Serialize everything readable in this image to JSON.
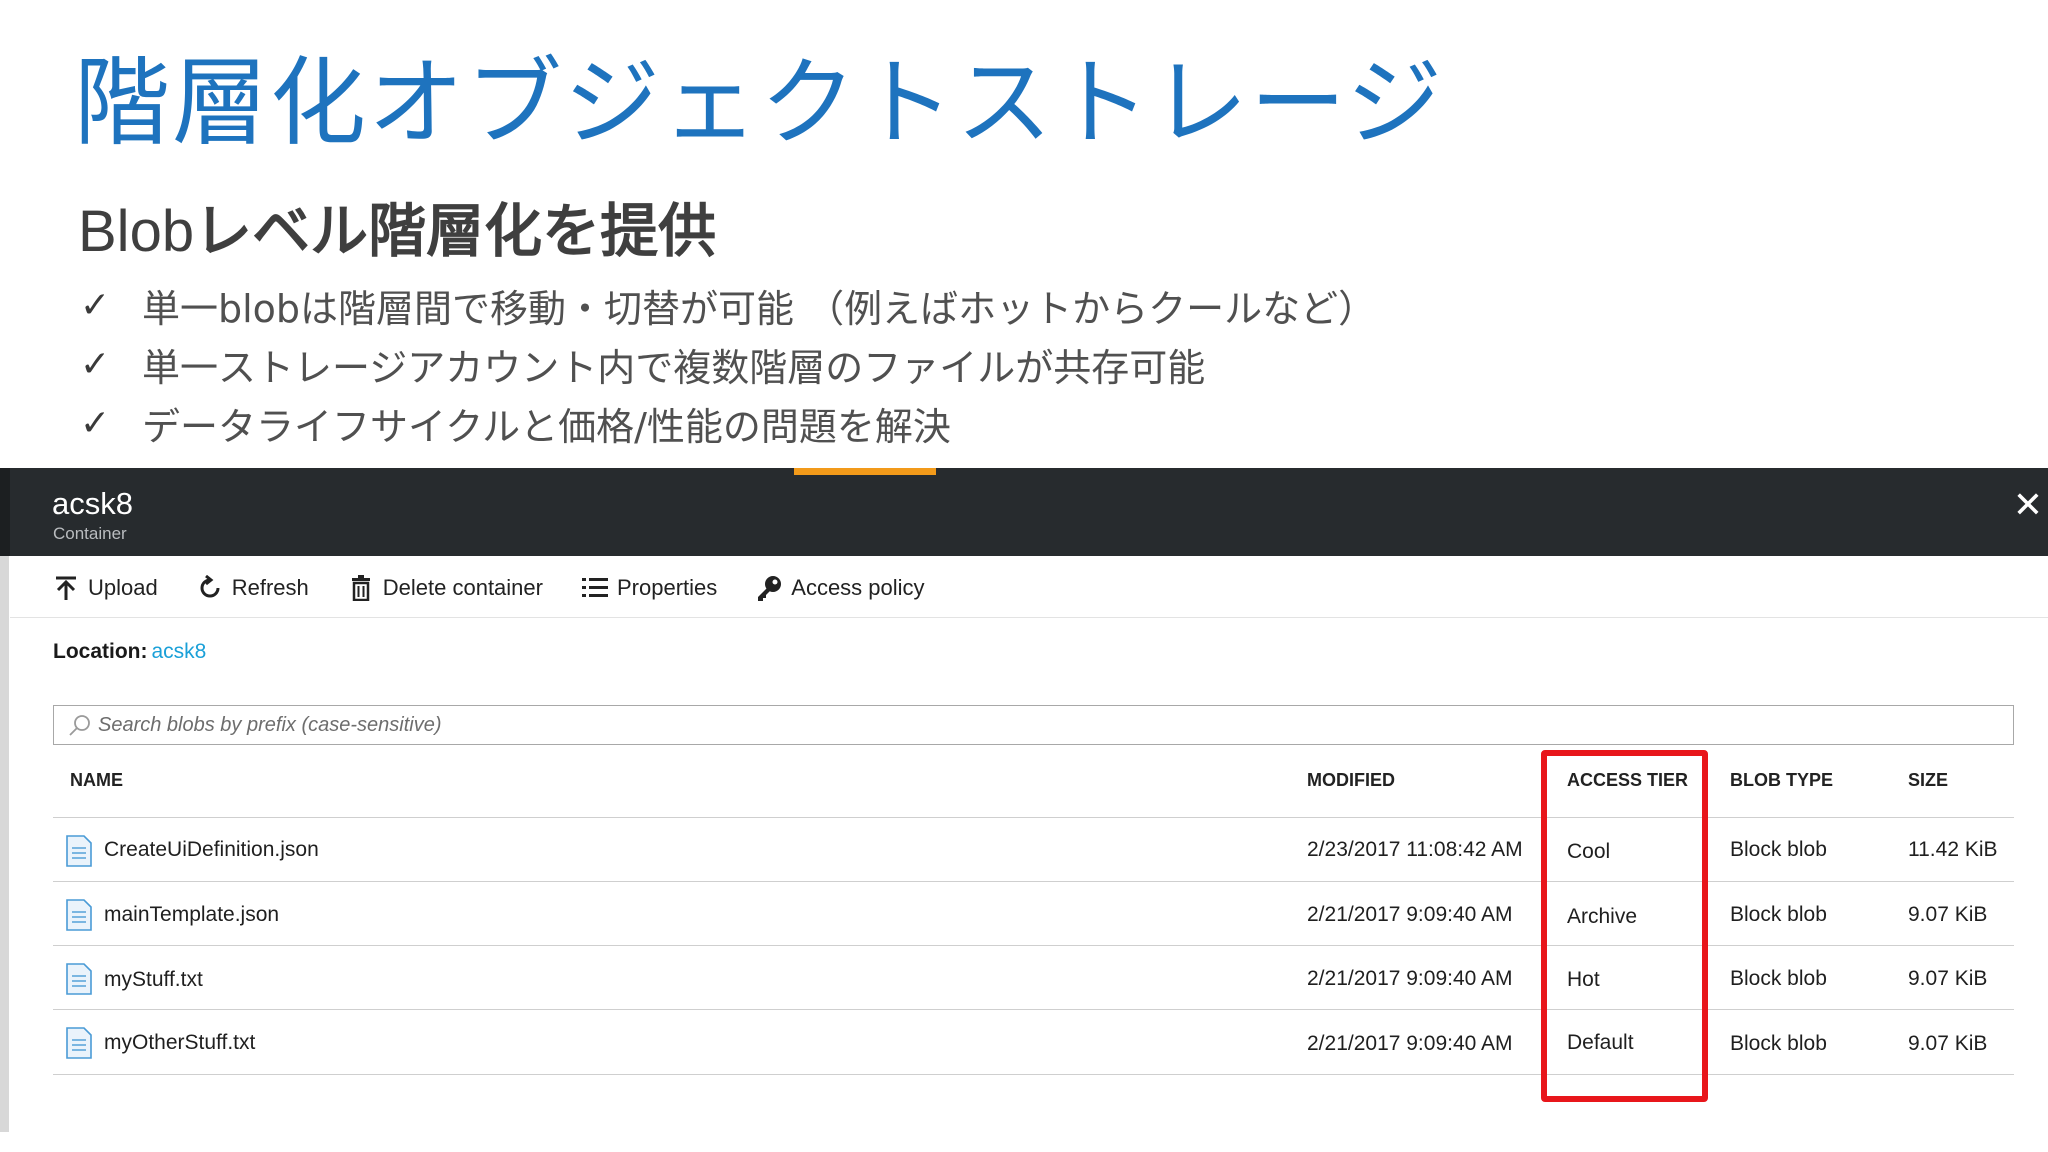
{
  "slide": {
    "title": "階層化オブジェクトストレージ",
    "subtitle_latin": "Blob",
    "subtitle_jp": "レベル階層化を提供",
    "check_glyph": "✓",
    "bullets": [
      "単一blobは階層間で移動・切替が可能 （例えばホットからクールなど）",
      "単一ストレージアカウント内で複数階層のファイルが共存可能",
      "データライフサイクルと価格/性能の問題を解決"
    ]
  },
  "blade": {
    "title": "acsk8",
    "subtitle": "Container",
    "close_glyph": "✕",
    "toolbar": [
      {
        "label": "Upload",
        "icon": "upload-icon"
      },
      {
        "label": "Refresh",
        "icon": "refresh-icon"
      },
      {
        "label": "Delete container",
        "icon": "trash-icon"
      },
      {
        "label": "Properties",
        "icon": "list-icon"
      },
      {
        "label": "Access policy",
        "icon": "key-icon"
      }
    ],
    "location_label": "Location:",
    "location_value": "acsk8",
    "search_placeholder": "Search blobs by prefix (case-sensitive)",
    "columns": [
      "NAME",
      "MODIFIED",
      "ACCESS TIER",
      "BLOB TYPE",
      "SIZE"
    ],
    "rows": [
      {
        "name": "CreateUiDefinition.json",
        "modified": "2/23/2017 11:08:42 AM",
        "tier": "Cool",
        "type": "Block blob",
        "size": "11.42 KiB"
      },
      {
        "name": "mainTemplate.json",
        "modified": "2/21/2017 9:09:40 AM",
        "tier": "Archive",
        "type": "Block blob",
        "size": "9.07 KiB"
      },
      {
        "name": "myStuff.txt",
        "modified": "2/21/2017 9:09:40 AM",
        "tier": "Hot",
        "type": "Block blob",
        "size": "9.07 KiB"
      },
      {
        "name": "myOtherStuff.txt",
        "modified": "2/21/2017 9:09:40 AM",
        "tier": "Default",
        "type": "Block blob",
        "size": "9.07 KiB"
      }
    ]
  },
  "colors": {
    "title_blue": "#1e73be",
    "header_dark": "#272b2e",
    "accent_orange": "#f29a1a",
    "link_blue": "#1aa0d8",
    "highlight_red": "#e8161b"
  }
}
